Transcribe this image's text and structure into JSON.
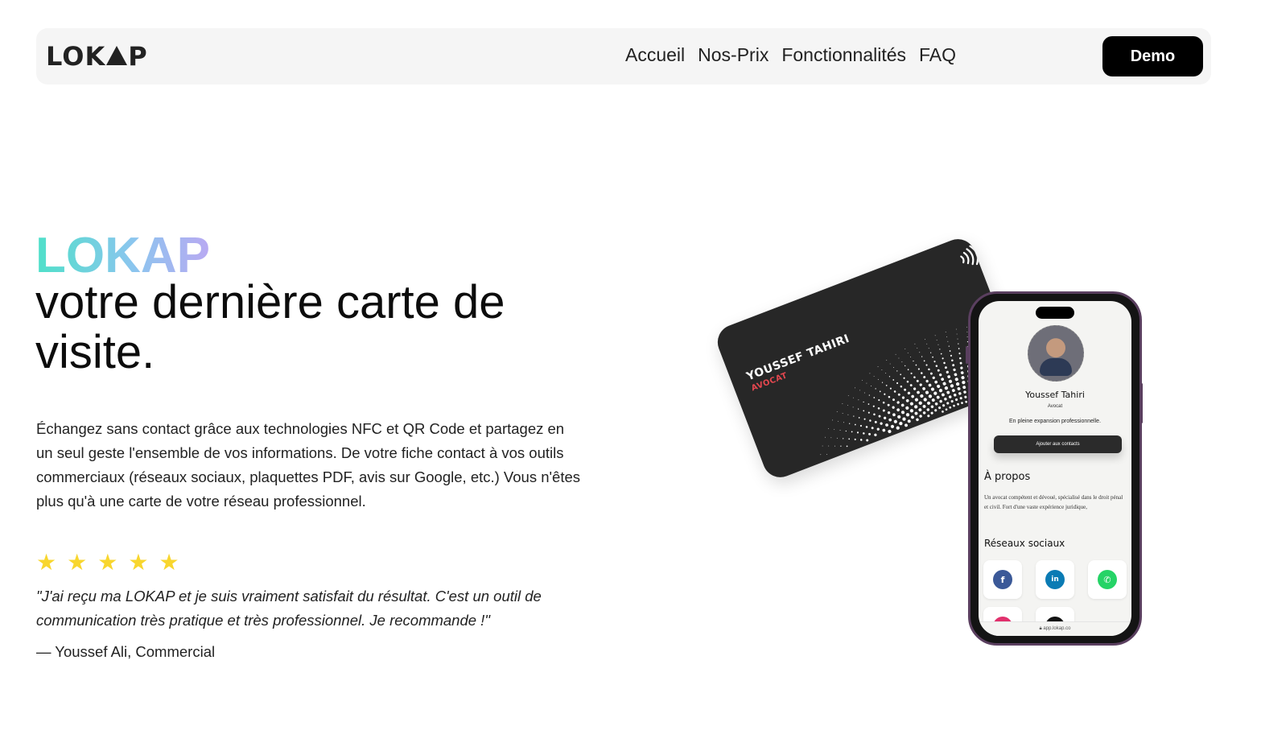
{
  "nav": {
    "logo_text": "LOKAP",
    "links": [
      "Accueil",
      "Nos-Prix",
      "Fonctionnalités",
      "FAQ"
    ],
    "demo_label": "Demo"
  },
  "hero": {
    "brand": "LOKAP",
    "title": "votre dernière carte de visite.",
    "description": "Échangez sans contact grâce aux technologies NFC et QR Code et partagez en un seul geste l'ensemble de vos informations. De votre fiche contact à vos outils commerciaux (réseaux sociaux, plaquettes PDF, avis sur Google, etc.) Vous n'êtes plus qu'à une carte de votre réseau professionnel.",
    "rating": 5,
    "quote": "\"J'ai reçu ma LOKAP et je suis vraiment satisfait du résultat. C'est un outil de communication très pratique et très professionnel. Je recommande !\"",
    "author": "— Youssef Ali, Commercial"
  },
  "card": {
    "name": "YOUSSEF TAHIRI",
    "role": "AVOCAT"
  },
  "phone": {
    "name": "Youssef Tahiri",
    "role": "Avocat",
    "tagline": "En pleine expansion professionnelle.",
    "add_contact": "Ajouter aux contacts",
    "about_title": "À propos",
    "about_text": "Un avocat compétent et dévoué, spécialisé dans le droit pénal et civil. Fort d'une vaste expérience juridique,",
    "social_title": "Réseaux sociaux",
    "url": "app.lokap.co",
    "socials": [
      {
        "icon": "facebook-icon",
        "glyph": "f",
        "color": "#3b5998"
      },
      {
        "icon": "linkedin-icon",
        "glyph": "in",
        "color": "#0a7bb4"
      },
      {
        "icon": "whatsapp-icon",
        "glyph": "✆",
        "color": "#25d366"
      },
      {
        "icon": "instagram-icon",
        "glyph": "◎",
        "color": "#e1306c"
      },
      {
        "icon": "tiktok-icon",
        "glyph": "♪",
        "color": "#111111"
      }
    ]
  },
  "colors": {
    "brand_gradient": [
      "#4fe0c9",
      "#8ac6ee",
      "#b9a9f2"
    ],
    "star": "#f8d62e",
    "button": "#000000"
  }
}
